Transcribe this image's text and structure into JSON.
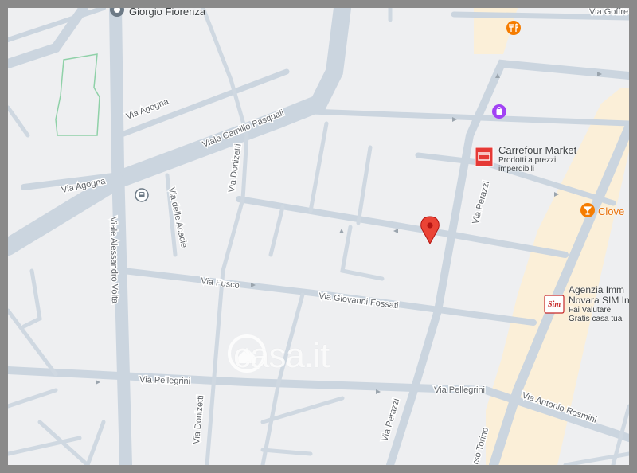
{
  "map": {
    "place_labels": {
      "top_place": "Giorgio Fiorenza",
      "carrefour_title": "Carrefour Market",
      "carrefour_line1": "Prodotti a prezzi",
      "carrefour_line2": "imperdibili",
      "clover": "Clove",
      "agency_line1": "Agenzia Imm",
      "agency_line2": "Novara SIM In",
      "agency_line3": "Fai Valutare",
      "agency_line4": "Gratis casa tua"
    },
    "street_labels": {
      "goffredo": "Via Goffre",
      "agogna_upper": "Via Agogna",
      "agogna_lower": "Via Agogna",
      "pasquali": "Viale Camillo Pasquali",
      "donizetti_upper": "Via Donizetti",
      "acacie": "Via delle Acacie",
      "volta": "Viale Alessandro Volta",
      "fusco": "Via Fusco",
      "fossati": "Via Giovanni Fossati",
      "pellegrini_left": "Via Pellegrini",
      "pellegrini_right": "Via Pellegrini",
      "rosmini": "Via Antonio Rosmini",
      "donizetti_lower": "Via Donizetti",
      "perazzi_upper": "Via Perazzi",
      "perazzi_lower": "Via Perazzi",
      "corso_torino": "rso Torino"
    },
    "watermark": "casa.it",
    "icons": {
      "marker": "location-pin-icon",
      "bus_stop": "bus-stop-icon",
      "restaurant": "restaurant-icon",
      "shop": "shopping-icon",
      "store": "store-icon",
      "bar": "cocktail-icon",
      "agency": "agency-logo-icon",
      "place": "place-icon"
    },
    "agency_logo_text": "Sim",
    "colors": {
      "pin": "#ea4335",
      "store": "#e53935",
      "food": "#f57c00",
      "shop": "#a142f4",
      "road": "#ccd5de",
      "background": "#eeeff1"
    }
  }
}
